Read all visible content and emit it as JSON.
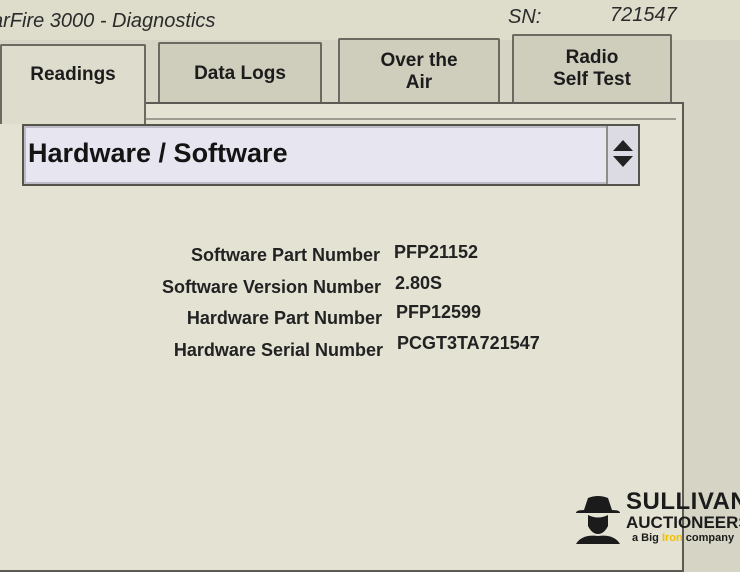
{
  "header": {
    "title": "arFire 3000 - Diagnostics",
    "sn_label": "SN:",
    "sn_value": "721547"
  },
  "tabs": [
    {
      "label": "Readings",
      "active": true
    },
    {
      "label": "Data Logs",
      "active": false
    },
    {
      "label": "Over the\nAir",
      "active": false
    },
    {
      "label": "Radio\nSelf Test",
      "active": false
    }
  ],
  "dropdown": {
    "selected": "Hardware / Software"
  },
  "info": {
    "rows": [
      {
        "label": "Software Part Number",
        "value": "PFP21152"
      },
      {
        "label": "Software Version Number",
        "value": "2.80S"
      },
      {
        "label": "Hardware Part Number",
        "value": "PFP12599"
      },
      {
        "label": "Hardware Serial Number",
        "value": "PCGT3TA721547"
      }
    ]
  },
  "watermark": {
    "line1": "SULLIVAN",
    "line2": "AUCTIONEERS",
    "line3_prefix": "a Big ",
    "line3_iron": "Iron",
    "line3_suffix": " company"
  },
  "colors": {
    "background": "#d6d5c5",
    "panel": "#e3e2d3",
    "dropdown": "#e7e6f0"
  }
}
